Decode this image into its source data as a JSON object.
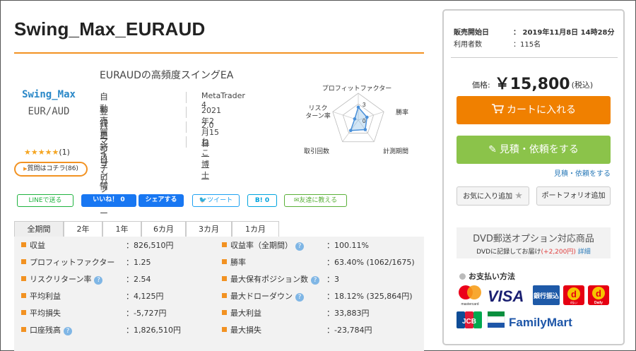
{
  "product": {
    "title": "Swing_Max_EURAUD",
    "subtitle": "EURAUDの高頻度スイングEA",
    "logo_line1": "Swing_Max",
    "logo_line2": "EUR/AUD",
    "stars": "★★★★★",
    "review_count": "(1)",
    "qa_label": "質問はコチラ(86)",
    "info": [
      {
        "label": "自動売買システム",
        "value": "MetaTrader 4"
      },
      {
        "label": "登録更新日",
        "value": "2021年2月15日"
      },
      {
        "label": "バージョン情報",
        "value": "2.0"
      },
      {
        "label": "マイプロフィール",
        "value": "ねこ博士"
      }
    ]
  },
  "radar": {
    "axes": [
      "プロフィットファクター",
      "勝率",
      "計測期間",
      "取引回数",
      "リスク\nターン率"
    ],
    "axis_line1": [
      "プロフィットファクター",
      "勝率",
      "計測期間",
      "取引回数",
      "リスク"
    ],
    "axis_line2": [
      "",
      "",
      "",
      "",
      "ターン率"
    ],
    "scale_labels": [
      "3",
      "0"
    ],
    "values": [
      2.4,
      1.7,
      2.2,
      2.4,
      0.7
    ],
    "max": 5,
    "fill_color": "#7fb6e5",
    "line_color": "#4a90d9"
  },
  "share": {
    "line": "LINEで送る",
    "like": "いいね！ 0",
    "fb_share": "シェアする",
    "tweet": "ツイート",
    "hatena": "B! 0",
    "friend": "友達に教える"
  },
  "tabs": [
    "全期間",
    "2年",
    "1年",
    "6カ月",
    "3カ月",
    "1カ月"
  ],
  "stats_left": [
    {
      "label": "収益",
      "value": "：826,510円",
      "help": false
    },
    {
      "label": "プロフィットファクター",
      "value": "：1.25",
      "help": false
    },
    {
      "label": "リスクリターン率",
      "value": "：2.54",
      "help": true
    },
    {
      "label": "平均利益",
      "value": "：4,125円",
      "help": false
    },
    {
      "label": "平均損失",
      "value": "：-5,727円",
      "help": false
    },
    {
      "label": "口座残高",
      "value": "：1,826,510円",
      "help": true
    }
  ],
  "stats_right": [
    {
      "label": "収益率（全期間）",
      "value": "：100.11%",
      "help": true
    },
    {
      "label": "勝率",
      "value": "：63.40% (1062/1675)",
      "help": false
    },
    {
      "label": "最大保有ポジション数",
      "value": "：3",
      "help": true
    },
    {
      "label": "最大ドローダウン",
      "value": "：18.12% (325,864円)",
      "help": true
    },
    {
      "label": "最大利益",
      "value": "：33,883円",
      "help": false
    },
    {
      "label": "最大損失",
      "value": "：-23,784円",
      "help": false
    }
  ],
  "sidebar": {
    "release_label": "販売開始日",
    "release_value": "： 2019年11月8日 14時28分",
    "users_label": "利用者数",
    "users_value": "：115名",
    "price_label": "価格:",
    "price_amount": "￥15,800",
    "price_tax": "(税込)",
    "cart_button": "カートに入れる",
    "quote_button": "見積・依頼をする",
    "quote_link": "見積・依頼をする",
    "fav_button": "お気に入り追加",
    "portfolio_button": "ポートフォリオ追加",
    "dvd_title": "DVD郵送オプション対応商品",
    "dvd_text": "DVDに記録してお届け",
    "dvd_price": "(+2,200円)",
    "dvd_link": "詳細",
    "payment_heading": "お支払い方法",
    "payment_methods": [
      "mastercard",
      "VISA",
      "銀行振込",
      "d払い",
      "Daily",
      "JCB",
      "FamilyMart"
    ]
  },
  "colors": {
    "accent_orange": "#f29222",
    "cart_orange": "#f08000",
    "quote_green": "#8bc34a",
    "link_blue": "#2a7ab8"
  }
}
